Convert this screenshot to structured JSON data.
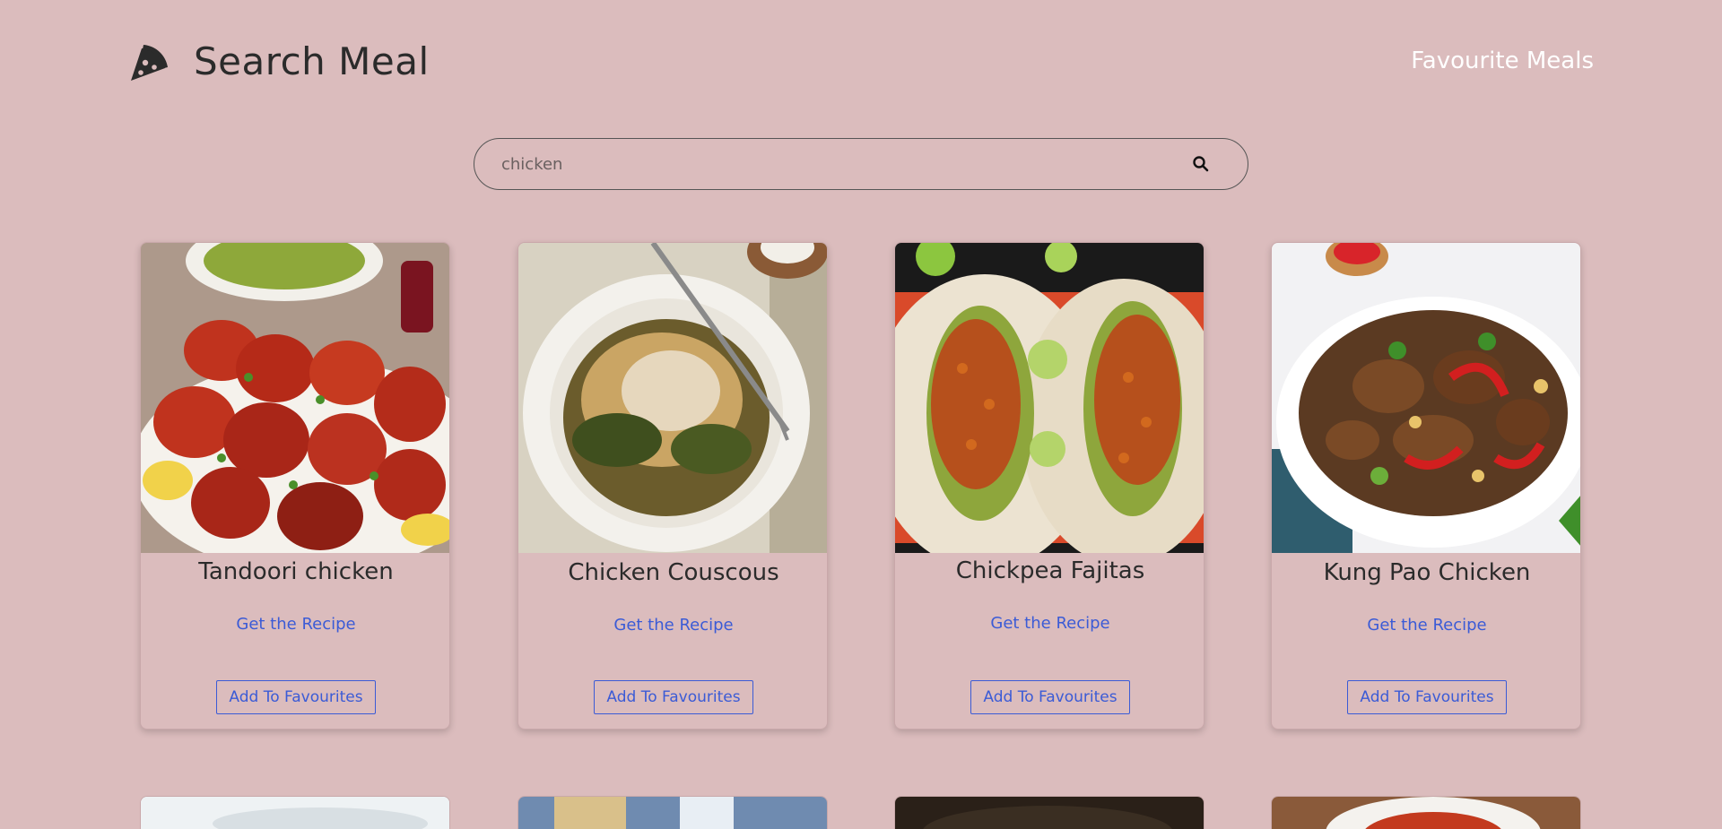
{
  "header": {
    "title": "Search Meal",
    "favourites_link": "Favourite Meals"
  },
  "search": {
    "value": "chicken",
    "placeholder": "chicken"
  },
  "meals": [
    {
      "title": "Tandoori chicken",
      "recipe_label": "Get the Recipe",
      "fav_label": "Add To Favourites"
    },
    {
      "title": "Chicken Couscous",
      "recipe_label": "Get the Recipe",
      "fav_label": "Add To Favourites"
    },
    {
      "title": "Chickpea Fajitas",
      "recipe_label": "Get the Recipe",
      "fav_label": "Add To Favourites"
    },
    {
      "title": "Kung Pao Chicken",
      "recipe_label": "Get the Recipe",
      "fav_label": "Add To Favourites"
    }
  ],
  "colors": {
    "background": "#dbbcbd",
    "accent": "#3b5bd6",
    "text": "#2b2b2b"
  }
}
